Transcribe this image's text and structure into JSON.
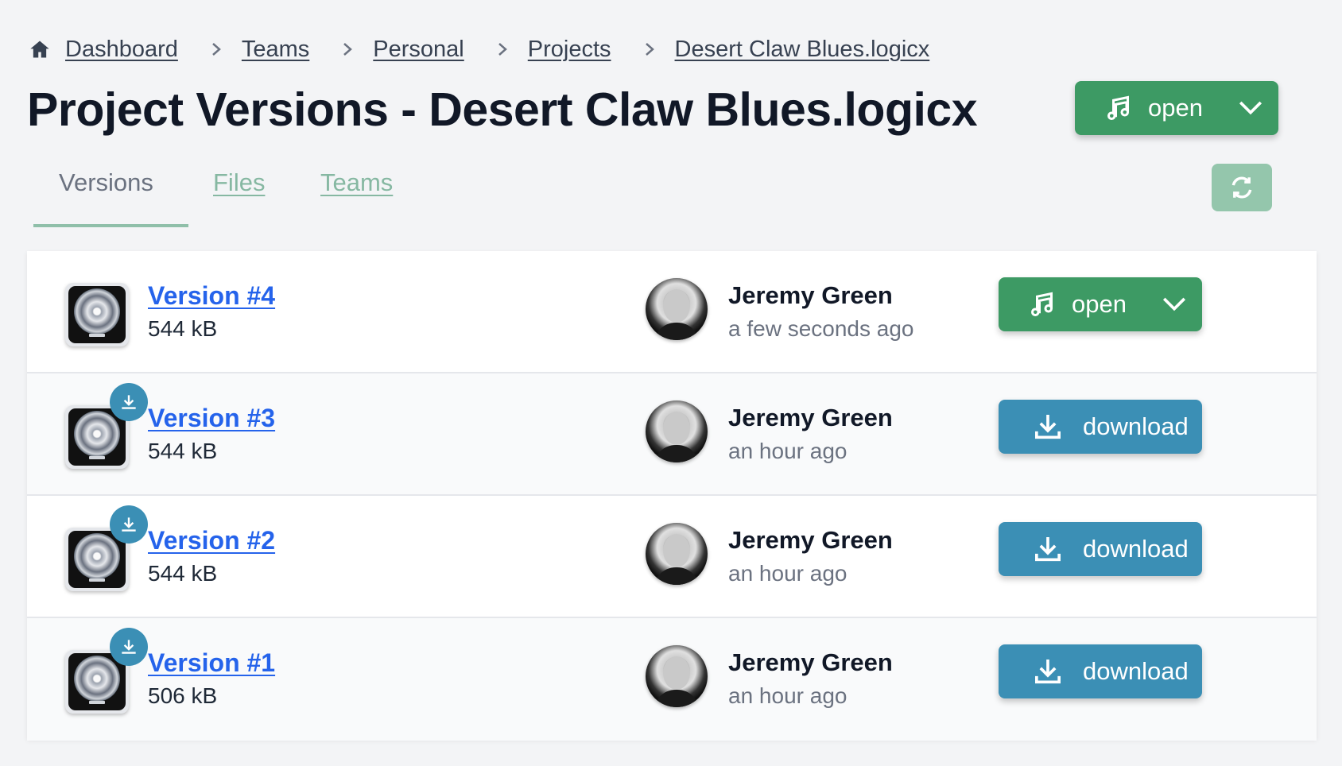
{
  "breadcrumb": {
    "items": [
      "Dashboard",
      "Teams",
      "Personal",
      "Projects",
      "Desert Claw Blues.logicx"
    ]
  },
  "header": {
    "title": "Project Versions - Desert Claw Blues.logicx",
    "open_label": "open"
  },
  "tabs": {
    "versions": "Versions",
    "files": "Files",
    "teams": "Teams"
  },
  "colors": {
    "open_green": "#3d9a64",
    "download_blue": "#3b8fb5",
    "link_blue": "#2563eb"
  },
  "versions": [
    {
      "name": "Version #4",
      "size": "544 kB",
      "user": "Jeremy Green",
      "time": "a few seconds ago",
      "action": "open",
      "badge": false
    },
    {
      "name": "Version #3",
      "size": "544 kB",
      "user": "Jeremy Green",
      "time": "an hour ago",
      "action": "download",
      "badge": true
    },
    {
      "name": "Version #2",
      "size": "544 kB",
      "user": "Jeremy Green",
      "time": "an hour ago",
      "action": "download",
      "badge": true
    },
    {
      "name": "Version #1",
      "size": "506 kB",
      "user": "Jeremy Green",
      "time": "an hour ago",
      "action": "download",
      "badge": true
    }
  ]
}
